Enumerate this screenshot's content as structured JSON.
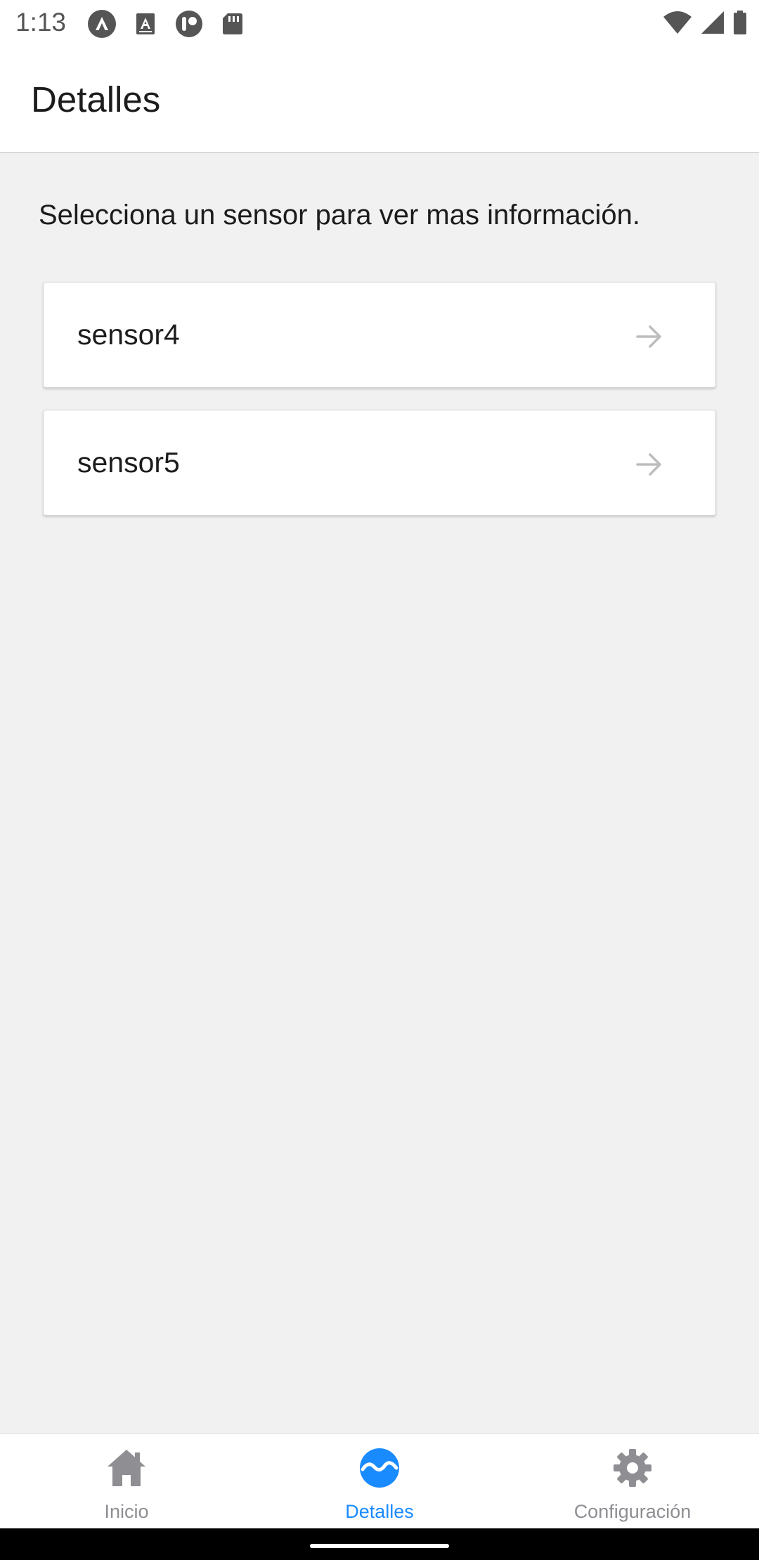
{
  "status_bar": {
    "time": "1:13",
    "left_icons": [
      "app-icon-a",
      "text-icon-a",
      "toggle-icon",
      "sd-card-icon"
    ],
    "right_icons": [
      "wifi-icon",
      "signal-icon",
      "battery-icon"
    ]
  },
  "header": {
    "title": "Detalles"
  },
  "main": {
    "intro": "Selecciona un sensor para ver mas información.",
    "sensors": [
      {
        "label": "sensor4"
      },
      {
        "label": "sensor5"
      }
    ]
  },
  "bottom_nav": {
    "items": [
      {
        "label": "Inicio",
        "icon": "home-icon",
        "active": false
      },
      {
        "label": "Detalles",
        "icon": "wave-circle-icon",
        "active": true
      },
      {
        "label": "Configuración",
        "icon": "gear-icon",
        "active": false
      }
    ]
  },
  "colors": {
    "accent": "#1a8bff",
    "inactive": "#8e8e93",
    "background": "#f1f1f1"
  }
}
